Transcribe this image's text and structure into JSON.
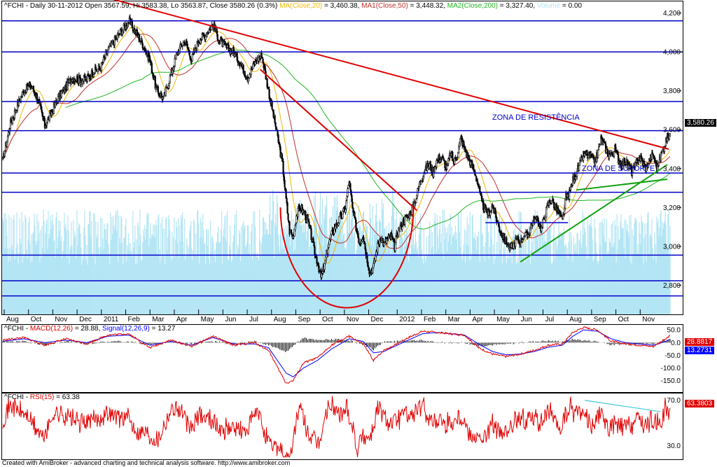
{
  "header": {
    "symbol": "^FCHI",
    "info": "- Daily 30-11-2012 Open 3567.59, Hi 3583.38, Lo 3563.87, Close 3580.26 (0.3%)",
    "ma20_label": "MA(Close,20)",
    "ma20_value": " = 3,460.38,",
    "ma50_label": "MA1(Close,50)",
    "ma50_value": " = 3,448.32,",
    "ma200_label": "MA2(Close,200)",
    "ma200_value": " = 3,327.40,",
    "volume_label": "Volume",
    "volume_value": " = 0.00"
  },
  "macd_header": {
    "symbol": "^FCHI",
    "macd_label": "MACD(12,26)",
    "macd_value": " = 28.88,",
    "signal_label": "Signal(12,26,9)",
    "signal_value": " = 13.27"
  },
  "rsi_header": {
    "symbol": "^FCHI",
    "rsi_label": "RSI(15)",
    "rsi_value": " = 63.38"
  },
  "annotations": {
    "resistance": "ZONA DE RESISTÊNCIA",
    "support": "ZONA DE SUPORTE"
  },
  "price_tag": "3,580.26",
  "macd_tags": {
    "macd": "28.8817",
    "signal": "13.2731"
  },
  "rsi_tag": "63.3803",
  "footer": "Created with AmiBroker - advanced charting and technical analysis software. http://www.amibroker.com",
  "colors": {
    "candle": "#000000",
    "ma20": "#f2b800",
    "ma50": "#c0302a",
    "ma200": "#22b522",
    "volume": "#b3e5f5",
    "hline": "#0000c8",
    "trend": "#e00000",
    "support_trend": "#10a010",
    "macd": "#0000ff",
    "signal": "#e00000",
    "rsi": "#e00000",
    "rsi_trend": "#40c8d8"
  },
  "chart_data": [
    {
      "type": "candlestick",
      "title": "^FCHI - Daily 30-11-2012",
      "x_tick_labels": [
        "Aug",
        "Oct",
        "Nov",
        "Dec",
        "2011",
        "Feb",
        "Mar",
        "Apr",
        "May",
        "Jun",
        "Jul",
        "Aug",
        "Sep",
        "Oct",
        "Nov",
        "Dec",
        "2012",
        "Feb",
        "Mar",
        "Apr",
        "May",
        "Jun",
        "Jul",
        "Aug",
        "Sep",
        "Oct",
        "Nov"
      ],
      "y_ticks": [
        2800,
        3000,
        3200,
        3400,
        3600,
        3800,
        4000,
        4200
      ],
      "y_tick_labels": [
        "2,800",
        "3,000",
        "3,200",
        "3,400",
        "3,600",
        "3,800",
        "4,000",
        "4,200"
      ],
      "ylim": [
        2650,
        4260
      ],
      "ohlc_last": {
        "open": 3567.59,
        "high": 3583.38,
        "low": 3563.87,
        "close": 3580.26
      },
      "close_anchors": [
        [
          0,
          3440
        ],
        [
          10,
          3620
        ],
        [
          20,
          3720
        ],
        [
          30,
          3800
        ],
        [
          40,
          3830
        ],
        [
          50,
          3760
        ],
        [
          60,
          3620
        ],
        [
          70,
          3690
        ],
        [
          80,
          3770
        ],
        [
          90,
          3820
        ],
        [
          100,
          3870
        ],
        [
          110,
          3860
        ],
        [
          120,
          3860
        ],
        [
          130,
          3900
        ],
        [
          140,
          3920
        ],
        [
          150,
          4010
        ],
        [
          160,
          4060
        ],
        [
          170,
          4110
        ],
        [
          180,
          4160
        ],
        [
          190,
          4100
        ],
        [
          200,
          4040
        ],
        [
          210,
          3960
        ],
        [
          220,
          3800
        ],
        [
          230,
          3760
        ],
        [
          240,
          3880
        ],
        [
          250,
          4000
        ],
        [
          260,
          4060
        ],
        [
          270,
          3960
        ],
        [
          280,
          4060
        ],
        [
          290,
          4090
        ],
        [
          300,
          4140
        ],
        [
          310,
          4060
        ],
        [
          320,
          4020
        ],
        [
          330,
          4000
        ],
        [
          340,
          3940
        ],
        [
          350,
          3870
        ],
        [
          360,
          3940
        ],
        [
          370,
          3990
        ],
        [
          380,
          3800
        ],
        [
          390,
          3620
        ],
        [
          400,
          3420
        ],
        [
          405,
          3240
        ],
        [
          410,
          3080
        ],
        [
          415,
          3050
        ],
        [
          420,
          3160
        ],
        [
          425,
          3200
        ],
        [
          430,
          3180
        ],
        [
          435,
          3140
        ],
        [
          440,
          3070
        ],
        [
          445,
          2980
        ],
        [
          450,
          2920
        ],
        [
          455,
          2840
        ],
        [
          460,
          2900
        ],
        [
          465,
          3000
        ],
        [
          470,
          3060
        ],
        [
          475,
          3100
        ],
        [
          480,
          3130
        ],
        [
          485,
          3160
        ],
        [
          490,
          3200
        ],
        [
          495,
          3340
        ],
        [
          500,
          3190
        ],
        [
          505,
          3100
        ],
        [
          510,
          3020
        ],
        [
          515,
          3060
        ],
        [
          520,
          2950
        ],
        [
          525,
          2860
        ],
        [
          530,
          2900
        ],
        [
          535,
          2990
        ],
        [
          540,
          3050
        ],
        [
          545,
          3010
        ],
        [
          550,
          3040
        ],
        [
          555,
          3050
        ],
        [
          560,
          3000
        ],
        [
          565,
          3080
        ],
        [
          570,
          3110
        ],
        [
          575,
          3140
        ],
        [
          580,
          3160
        ],
        [
          585,
          3190
        ],
        [
          590,
          3240
        ],
        [
          595,
          3310
        ],
        [
          600,
          3370
        ],
        [
          605,
          3400
        ],
        [
          610,
          3420
        ],
        [
          615,
          3380
        ],
        [
          620,
          3440
        ],
        [
          625,
          3460
        ],
        [
          630,
          3440
        ],
        [
          635,
          3400
        ],
        [
          640,
          3480
        ],
        [
          645,
          3430
        ],
        [
          650,
          3480
        ],
        [
          655,
          3560
        ],
        [
          660,
          3500
        ],
        [
          665,
          3460
        ],
        [
          670,
          3420
        ],
        [
          675,
          3380
        ],
        [
          680,
          3310
        ],
        [
          685,
          3220
        ],
        [
          690,
          3180
        ],
        [
          695,
          3170
        ],
        [
          700,
          3210
        ],
        [
          705,
          3150
        ],
        [
          710,
          3090
        ],
        [
          715,
          3050
        ],
        [
          720,
          3020
        ],
        [
          725,
          2990
        ],
        [
          730,
          3010
        ],
        [
          735,
          3040
        ],
        [
          740,
          3020
        ],
        [
          745,
          3060
        ],
        [
          750,
          3050
        ],
        [
          755,
          3110
        ],
        [
          760,
          3140
        ],
        [
          765,
          3130
        ],
        [
          770,
          3090
        ],
        [
          775,
          3160
        ],
        [
          780,
          3220
        ],
        [
          785,
          3240
        ],
        [
          790,
          3200
        ],
        [
          795,
          3170
        ],
        [
          800,
          3130
        ],
        [
          805,
          3250
        ],
        [
          810,
          3270
        ],
        [
          815,
          3340
        ],
        [
          820,
          3380
        ],
        [
          825,
          3420
        ],
        [
          830,
          3470
        ],
        [
          835,
          3470
        ],
        [
          840,
          3460
        ],
        [
          845,
          3430
        ],
        [
          850,
          3470
        ],
        [
          855,
          3550
        ],
        [
          860,
          3520
        ],
        [
          865,
          3480
        ],
        [
          870,
          3470
        ],
        [
          875,
          3500
        ],
        [
          880,
          3450
        ],
        [
          885,
          3420
        ],
        [
          890,
          3440
        ],
        [
          895,
          3410
        ],
        [
          900,
          3380
        ],
        [
          905,
          3420
        ],
        [
          910,
          3460
        ],
        [
          915,
          3430
        ],
        [
          920,
          3400
        ],
        [
          925,
          3450
        ],
        [
          930,
          3470
        ],
        [
          935,
          3400
        ],
        [
          940,
          3460
        ],
        [
          945,
          3510
        ],
        [
          950,
          3560
        ],
        [
          954,
          3580
        ]
      ],
      "lines": {
        "horizontal_levels": [
          4160,
          4000,
          3745,
          3595,
          3377,
          3278,
          2955,
          2823,
          2745
        ],
        "short_levels": [
          {
            "y": 3122,
            "from_bar": 690,
            "to_bar": 808
          }
        ],
        "resistance_trendline": [
          [
            148,
            4280
          ],
          [
            952,
            3500
          ]
        ],
        "fall_trendline": [
          [
            368,
            3910
          ],
          [
            592,
            3185
          ]
        ],
        "support_trendline": [
          [
            740,
            2920
          ],
          [
            950,
            3420
          ]
        ],
        "support_trendline_2": [
          [
            820,
            3290
          ],
          [
            950,
            3345
          ]
        ]
      }
    },
    {
      "type": "line",
      "title": "MACD(12,26)",
      "series": [
        {
          "name": "MACD(12,26)",
          "last": 28.88
        },
        {
          "name": "Signal(12,26,9)",
          "last": 13.27
        }
      ],
      "y_ticks": [
        50,
        0,
        -50,
        -100,
        -150
      ],
      "y_tick_labels": [
        "50.0",
        "0.0",
        "-50.0",
        "-100.0",
        "-150.0"
      ],
      "ylim": [
        -195,
        70
      ],
      "macd_anchors": [
        [
          0,
          10
        ],
        [
          30,
          20
        ],
        [
          60,
          -10
        ],
        [
          90,
          15
        ],
        [
          120,
          -5
        ],
        [
          150,
          30
        ],
        [
          180,
          35
        ],
        [
          210,
          -20
        ],
        [
          240,
          10
        ],
        [
          270,
          -15
        ],
        [
          300,
          25
        ],
        [
          330,
          -10
        ],
        [
          360,
          0
        ],
        [
          380,
          -30
        ],
        [
          395,
          -110
        ],
        [
          405,
          -160
        ],
        [
          415,
          -150
        ],
        [
          430,
          -80
        ],
        [
          450,
          -60
        ],
        [
          470,
          -10
        ],
        [
          495,
          25
        ],
        [
          515,
          -5
        ],
        [
          530,
          -70
        ],
        [
          545,
          -30
        ],
        [
          560,
          -10
        ],
        [
          580,
          20
        ],
        [
          600,
          45
        ],
        [
          620,
          40
        ],
        [
          640,
          35
        ],
        [
          660,
          30
        ],
        [
          680,
          -20
        ],
        [
          700,
          -45
        ],
        [
          720,
          -55
        ],
        [
          740,
          -45
        ],
        [
          760,
          -30
        ],
        [
          780,
          -10
        ],
        [
          800,
          -5
        ],
        [
          815,
          40
        ],
        [
          830,
          60
        ],
        [
          850,
          50
        ],
        [
          870,
          5
        ],
        [
          890,
          -5
        ],
        [
          910,
          -10
        ],
        [
          930,
          -15
        ],
        [
          945,
          10
        ],
        [
          954,
          29
        ]
      ],
      "signal_anchors": [
        [
          0,
          5
        ],
        [
          30,
          15
        ],
        [
          60,
          0
        ],
        [
          90,
          10
        ],
        [
          120,
          0
        ],
        [
          150,
          25
        ],
        [
          180,
          30
        ],
        [
          210,
          -10
        ],
        [
          240,
          5
        ],
        [
          270,
          -10
        ],
        [
          300,
          20
        ],
        [
          330,
          -5
        ],
        [
          360,
          -5
        ],
        [
          380,
          -20
        ],
        [
          395,
          -80
        ],
        [
          405,
          -120
        ],
        [
          415,
          -135
        ],
        [
          430,
          -100
        ],
        [
          450,
          -70
        ],
        [
          470,
          -25
        ],
        [
          495,
          15
        ],
        [
          515,
          5
        ],
        [
          530,
          -40
        ],
        [
          545,
          -35
        ],
        [
          560,
          -15
        ],
        [
          580,
          10
        ],
        [
          600,
          35
        ],
        [
          620,
          40
        ],
        [
          640,
          35
        ],
        [
          660,
          30
        ],
        [
          680,
          -5
        ],
        [
          700,
          -35
        ],
        [
          720,
          -48
        ],
        [
          740,
          -45
        ],
        [
          760,
          -35
        ],
        [
          780,
          -18
        ],
        [
          800,
          -10
        ],
        [
          815,
          25
        ],
        [
          830,
          50
        ],
        [
          850,
          45
        ],
        [
          870,
          15
        ],
        [
          890,
          0
        ],
        [
          910,
          -5
        ],
        [
          930,
          -10
        ],
        [
          945,
          2
        ],
        [
          954,
          13
        ]
      ]
    },
    {
      "type": "line",
      "title": "RSI(15)",
      "series": [
        {
          "name": "RSI(15)",
          "last": 63.38
        }
      ],
      "y_ticks": [
        70,
        30
      ],
      "y_tick_labels": [
        "70.0",
        "30.0"
      ],
      "ylim": [
        18,
        76
      ],
      "rsi_trendline": [
        [
          832,
          70
        ],
        [
          940,
          60
        ]
      ]
    }
  ]
}
